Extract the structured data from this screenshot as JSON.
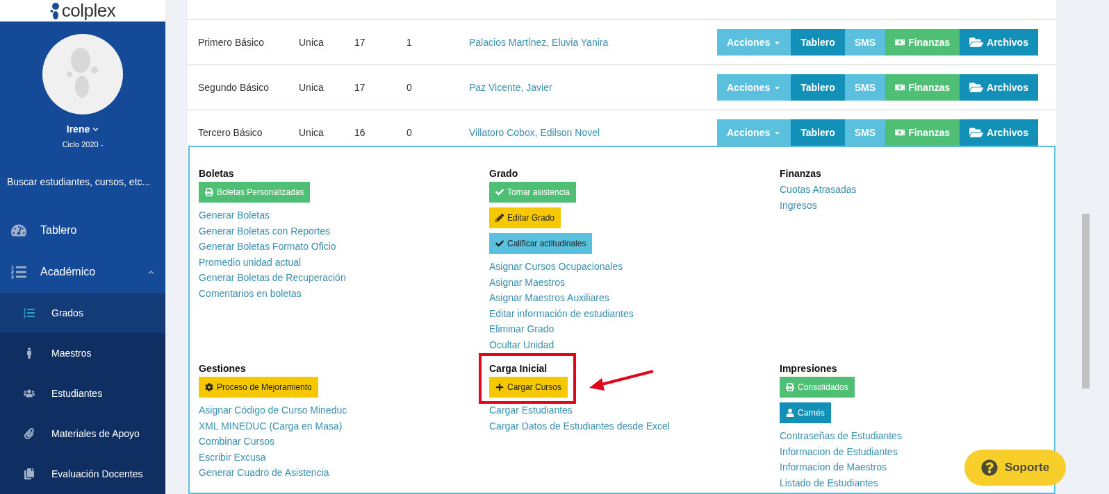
{
  "sidebar": {
    "logo": "colplex",
    "user": {
      "name": "Irene",
      "cycle": "Ciclo 2020 -"
    },
    "search": {
      "placeholder": "Buscar estudiantes, cursos, etc..."
    },
    "items": [
      {
        "label": "Tablero",
        "kind": "gauge"
      },
      {
        "label": "Académico",
        "kind": "list",
        "expanded": true,
        "children": [
          {
            "label": "Grados",
            "kind": "list",
            "selected": true
          },
          {
            "label": "Maestros",
            "kind": "person",
            "selected": false
          },
          {
            "label": "Estudiantes",
            "kind": "group",
            "selected": false
          },
          {
            "label": "Materiales de Apoyo",
            "kind": "clip",
            "selected": false
          },
          {
            "label": "Evaluación Docentes",
            "kind": "copy",
            "selected": false
          }
        ]
      }
    ]
  },
  "table": {
    "rows": [
      {
        "grade": "Primero Básico",
        "section": "Unica",
        "students": "17",
        "column_4": "1",
        "teacher": "Palacios Martínez, Eluvia Yanira",
        "expanded": false,
        "actions": [
          {
            "label": "Acciones",
            "kind": "dropdown",
            "color": "#5bc0de"
          },
          {
            "label": "Tablero",
            "kind": "plain",
            "color": "#1390b8"
          },
          {
            "label": "SMS",
            "kind": "plain",
            "color": "#5bc0de"
          },
          {
            "label": "Finanzas",
            "kind": "money",
            "color": "#4fbf75"
          },
          {
            "label": "Archivos",
            "kind": "folder",
            "color": "#1390b8"
          }
        ]
      },
      {
        "grade": "Segundo Básico",
        "section": "Unica",
        "students": "17",
        "column_4": "0",
        "teacher": "Paz Vicente, Javier",
        "expanded": false,
        "actions": [
          {
            "label": "Acciones",
            "kind": "dropdown",
            "color": "#5bc0de"
          },
          {
            "label": "Tablero",
            "kind": "plain",
            "color": "#1390b8"
          },
          {
            "label": "SMS",
            "kind": "plain",
            "color": "#5bc0de"
          },
          {
            "label": "Finanzas",
            "kind": "money",
            "color": "#4fbf75"
          },
          {
            "label": "Archivos",
            "kind": "folder",
            "color": "#1390b8"
          }
        ]
      },
      {
        "grade": "Tercero Básico",
        "section": "Unica",
        "students": "16",
        "column_4": "0",
        "teacher": "Villatoro Cobox, Edilson Novel",
        "expanded": true,
        "actions": [
          {
            "label": "Acciones",
            "kind": "dropdown",
            "color": "#5bc0de"
          },
          {
            "label": "Tablero",
            "kind": "plain",
            "color": "#1390b8"
          },
          {
            "label": "SMS",
            "kind": "plain",
            "color": "#5bc0de"
          },
          {
            "label": "Finanzas",
            "kind": "money",
            "color": "#4fbf75"
          },
          {
            "label": "Archivos",
            "kind": "folder",
            "color": "#1390b8"
          }
        ]
      }
    ]
  },
  "details": {
    "sections": [
      {
        "title": "Boletas",
        "buttons": [
          {
            "label": "Boletas Personalizadas",
            "kind": "print",
            "color": "#4fbf75"
          }
        ],
        "links": [
          "Generar Boletas",
          "Generar Boletas con Reportes",
          "Generar Boletas Formato Oficio",
          "Promedio unidad actual",
          "Generar Boletas de Recuperación",
          "Comentarios en boletas"
        ]
      },
      {
        "title": "Grado",
        "buttons": [
          {
            "label": "Tomar asistencia",
            "kind": "check",
            "color": "#4fbf75"
          },
          {
            "label": "Editar Grado",
            "kind": "pencil",
            "color": "#f5c800"
          },
          {
            "label": "Calificar actitudinales",
            "kind": "check",
            "color": "#5bc0de"
          }
        ],
        "links": [
          "Asignar Cursos Ocupacionales",
          "Asignar Maestros",
          "Asignar Maestros Auxiliares",
          "Editar información de estudiantes",
          "Eliminar Grado",
          "Ocultar Unidad"
        ]
      },
      {
        "title": "Finanzas",
        "links": [
          "Cuotas Atrasadas",
          "Ingresos"
        ]
      },
      {
        "title": "Gestiones",
        "buttons": [
          {
            "label": "Proceso de Mejoramiento",
            "kind": "gear",
            "color": "#f5c800"
          }
        ],
        "links": [
          "Asignar Código de Curso Mineduc",
          "XML MINEDUC (Carga en Masa)",
          "Combinar Cursos",
          "Escribir Excusa",
          "Generar Cuadro de Asistencia"
        ]
      },
      {
        "title": "Carga Inicial",
        "highlighted": true,
        "buttons": [
          {
            "label": "Cargar Cursos",
            "kind": "plus",
            "color": "#f5c800"
          }
        ],
        "links": [
          "Cargar Estudiantes",
          "Cargar Datos de Estudiantes desde Excel"
        ]
      },
      {
        "title": "Impresiones",
        "buttons": [
          {
            "label": "Consolidados",
            "kind": "print",
            "color": "#4fbf75"
          },
          {
            "label": "Carnés",
            "kind": "user",
            "color": "#1390b8"
          }
        ],
        "links": [
          "Contraseñas de Estudiantes",
          "Informacion de Estudiantes",
          "Informacion de Maestros",
          "Listado de Estudiantes"
        ]
      }
    ]
  },
  "support_button": {
    "label": "Soporte"
  }
}
